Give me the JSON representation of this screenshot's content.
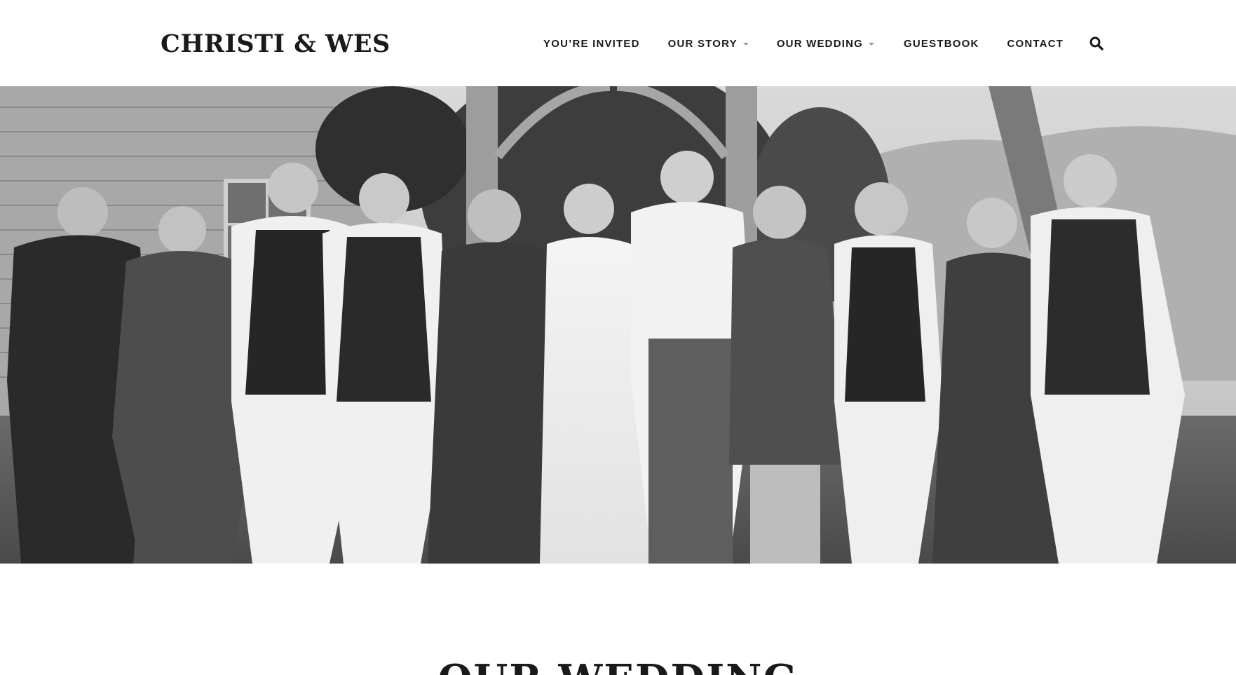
{
  "site": {
    "title": "CHRISTI & WES"
  },
  "nav": {
    "items": [
      {
        "label": "YOU’RE INVITED",
        "has_dropdown": false
      },
      {
        "label": "OUR STORY",
        "has_dropdown": true
      },
      {
        "label": "OUR WEDDING",
        "has_dropdown": true
      },
      {
        "label": "GUESTBOOK",
        "has_dropdown": false
      },
      {
        "label": "CONTACT",
        "has_dropdown": false
      }
    ],
    "search_icon": "search-icon"
  },
  "hero": {
    "image_icon": "wedding-party-photo",
    "style": "black-and-white"
  },
  "page": {
    "heading": "OUR WEDDING"
  },
  "colors": {
    "text": "#1a1a1a",
    "caret": "#9a9a9a",
    "background": "#ffffff"
  }
}
